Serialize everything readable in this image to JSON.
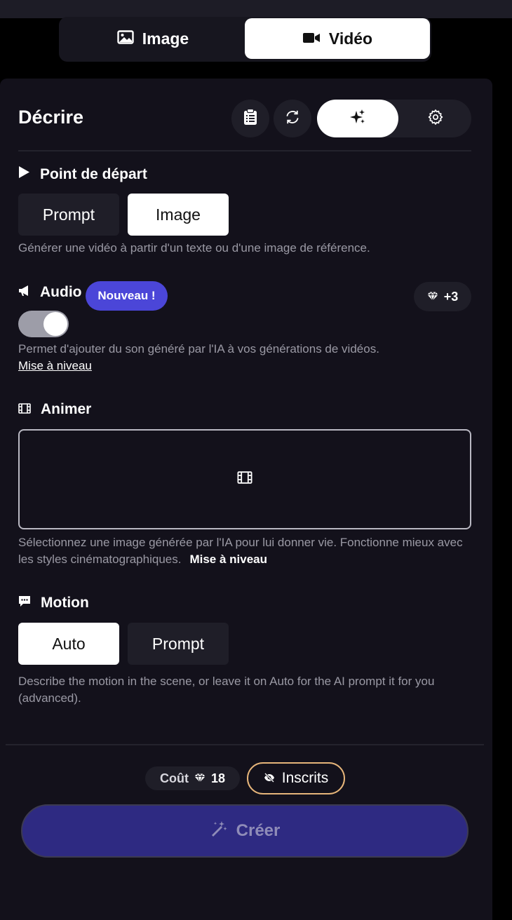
{
  "mode_switch": {
    "image_label": "Image",
    "video_label": "Vidéo"
  },
  "header": {
    "title": "Décrire"
  },
  "start_point": {
    "title": "Point de départ",
    "options": [
      "Prompt",
      "Image"
    ],
    "selected": "Image",
    "help": "Générer une vidéo à partir d'un texte ou d'une image de référence."
  },
  "audio": {
    "title": "Audio",
    "badge": "Nouveau !",
    "cost": "+3",
    "enabled": true,
    "help": "Permet d'ajouter du son généré par l'IA à vos générations de vidéos.",
    "upgrade_link": "Mise à niveau"
  },
  "animate": {
    "title": "Animer",
    "help": "Sélectionnez une image générée par l'IA pour lui donner vie. Fonctionne mieux avec les styles cinématographiques.",
    "upgrade_link": "Mise à niveau"
  },
  "motion": {
    "title": "Motion",
    "options": [
      "Auto",
      "Prompt"
    ],
    "selected": "Auto",
    "help": "Describe the motion in the scene, or leave it on Auto for the AI prompt it for you (advanced)."
  },
  "footer": {
    "cost_label": "Coût",
    "cost_value": "18",
    "visibility_label": "Inscrits",
    "create_label": "Créer"
  },
  "colors": {
    "accent": "#4b46d8",
    "create_button": "#2e2a82",
    "visibility_border": "#e6b57a",
    "panel": "#13111b"
  }
}
